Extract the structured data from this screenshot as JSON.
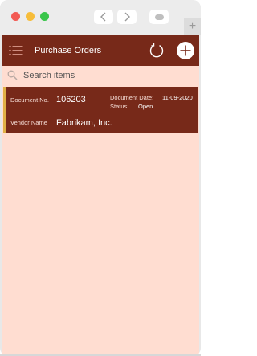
{
  "browser": {
    "new_tab_label": "+"
  },
  "header": {
    "title": "Purchase Orders",
    "background_color": "#772919"
  },
  "search": {
    "placeholder": "Search items",
    "value": ""
  },
  "orders": [
    {
      "document_no_label": "Document No.",
      "document_no": "106203",
      "document_date_label": "Document Date:",
      "document_date": "11-09-2020",
      "status_label": "Status:",
      "status": "Open",
      "vendor_name_label": "Vendor Name",
      "vendor_name": "Fabrikam, Inc."
    }
  ],
  "colors": {
    "page_background": "#ffddd1",
    "card_accent": "#e0b046"
  },
  "icons": [
    "menu-icon",
    "refresh-icon",
    "add-icon",
    "search-icon",
    "chevron-left-icon",
    "chevron-right-icon",
    "tabs-icon"
  ]
}
